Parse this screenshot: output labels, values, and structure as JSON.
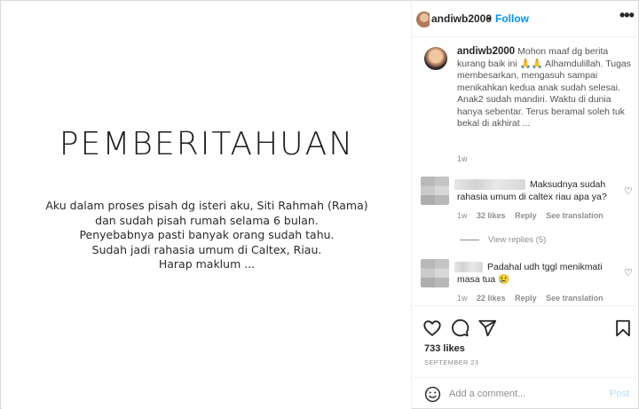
{
  "post_image": {
    "headline": "PEMBERITAHUAN",
    "body_lines": [
      "Aku dalam proses pisah dg isteri aku, Siti Rahmah (Rama)",
      "dan sudah pisah rumah selama 6 bulan.",
      "Penyebabnya pasti banyak orang sudah tahu.",
      "Sudah jadi rahasia umum di Caltex, Riau.",
      "Harap maklum ..."
    ]
  },
  "header": {
    "username": "andiwb2000",
    "separator": "•",
    "follow_label": "Follow",
    "more_icon": "more-dots-icon",
    "more_glyph": "•••"
  },
  "caption": {
    "username": "andiwb2000",
    "text": "Mohon maaf dg berita kurang baik ini 🙏🙏 Alhamdulillah. Tugas membesarkan, mengasuh sampai menikahkan kedua anak sudah selesai. Anak2 sudah mandiri. Waktu di dunia hanya sebentar. Terus beramal soleh tuk bekal di akhirat ...",
    "time": "1w"
  },
  "comments": [
    {
      "text": "Maksudnya sudah rahasia umum di caltex riau apa ya?",
      "time": "1w",
      "likes": "32 likes",
      "reply_label": "Reply",
      "translate_label": "See translation"
    },
    {
      "text": "Padahal udh tggl menikmati masa tua 😢",
      "time": "1w",
      "likes": "22 likes",
      "reply_label": "Reply",
      "translate_label": "See translation"
    }
  ],
  "view_replies_label": "View replies (5)",
  "heart_glyph": "♡",
  "actions": {
    "icons": [
      "heart-icon",
      "comment-icon",
      "share-icon",
      "save-icon"
    ],
    "likes": "733 likes",
    "date": "SEPTEMBER 23"
  },
  "add_comment": {
    "placeholder": "Add a comment...",
    "post_label": "Post"
  },
  "colors": {
    "accent": "#0095f6",
    "post_disabled": "#b2dffc",
    "secondary_text": "#8e8e8e",
    "border": "#dbdbdb"
  }
}
